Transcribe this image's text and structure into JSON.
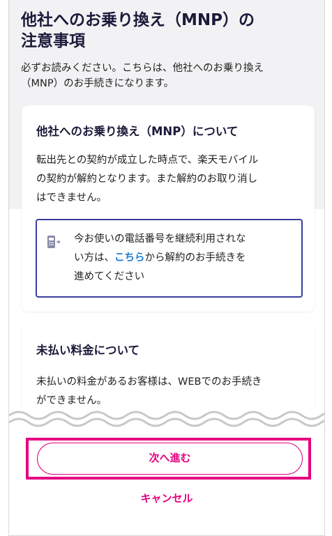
{
  "header": {
    "title_line1": "他社へのお乗り換え（MNP）の",
    "title_line2": "注意事項",
    "intro_line1": "必ずお読みください。こちらは、他社へのお乗り換え",
    "intro_line2": "（MNP）のお手続きになります。"
  },
  "card1": {
    "title": "他社へのお乗り換え（MNP）について",
    "body_line1": "転出先との契約が成立した時点で、楽天モバイル",
    "body_line2": "の契約が解約となります。また解約のお取り消し",
    "body_line3": "はできません。",
    "notice": {
      "icon": "phone-transfer-icon",
      "line1": "今お使いの電話番号を継続利用されな",
      "line2_prefix": "い方は、",
      "link_text": "こちら",
      "line2_suffix": "から解約のお手続きを",
      "line3": "進めてください"
    }
  },
  "card2": {
    "title": "未払い料金について",
    "body_line1": "未払いの料金があるお客様は、WEBでのお手続き",
    "body_line2": "ができません。"
  },
  "actions": {
    "next_label": "次へ進む",
    "cancel_label": "キャンセル"
  },
  "colors": {
    "accent": "#e4007f",
    "link": "#1a7bd0",
    "notice_border": "#3a3d9c",
    "background": "#f2f2f4"
  }
}
